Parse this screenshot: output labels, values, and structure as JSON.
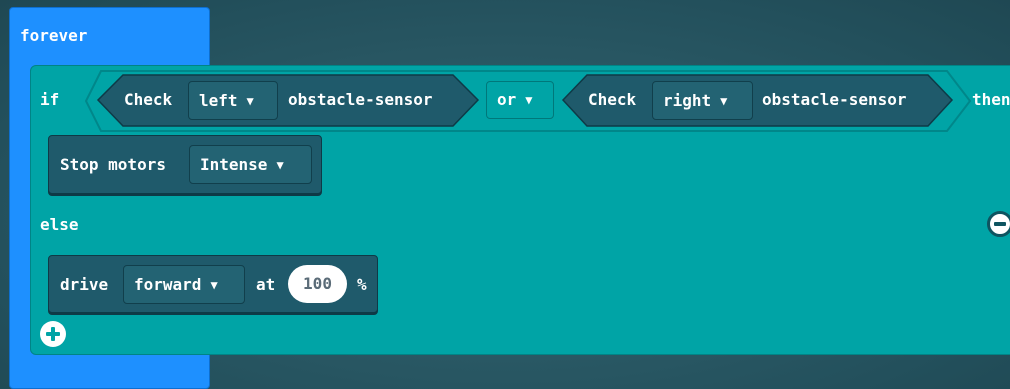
{
  "forever": {
    "label": "forever"
  },
  "if_block": {
    "if_label": "if",
    "then_label": "then",
    "else_label": "else"
  },
  "condition_left": {
    "check_label": "Check",
    "side": "left",
    "suffix": "obstacle-sensor"
  },
  "operator": {
    "label": "or"
  },
  "condition_right": {
    "check_label": "Check",
    "side": "right",
    "suffix": "obstacle-sensor"
  },
  "stop_block": {
    "label": "Stop motors",
    "mode": "Intense"
  },
  "drive_block": {
    "label": "drive",
    "direction": "forward",
    "at_label": "at",
    "speed": "100",
    "unit": "%"
  },
  "icons": {
    "caret": "caret-down-icon",
    "plus": "plus-circle-icon",
    "minus": "minus-circle-icon"
  },
  "colors": {
    "event_block": "#1e90ff",
    "logic_block": "#00a4a6",
    "motor_block": "#1f5a6b"
  }
}
